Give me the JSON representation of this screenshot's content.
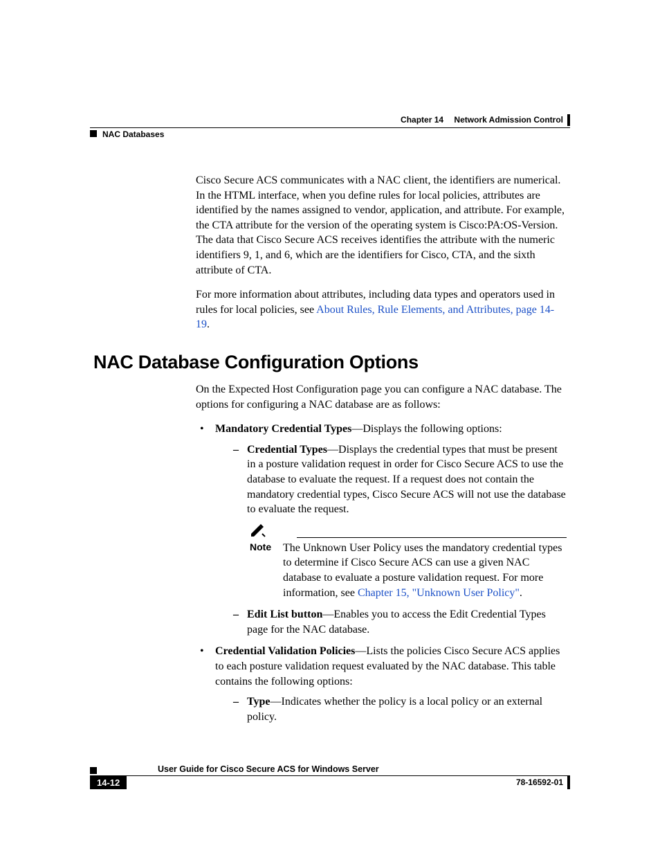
{
  "header": {
    "chapter_label": "Chapter 14",
    "chapter_title": "Network Admission Control",
    "section_crumb": "NAC Databases"
  },
  "intro": {
    "p1": "Cisco Secure ACS communicates with a NAC client, the identifiers are numerical. In the HTML interface, when you define rules for local policies, attributes are identified by the names assigned to vendor, application, and attribute. For example, the CTA attribute for the version of the operating system is Cisco:PA:OS-Version. The data that Cisco Secure ACS receives identifies the attribute with the numeric identifiers 9, 1, and 6, which are the identifiers for Cisco, CTA, and the sixth attribute of CTA.",
    "p2_pre": "For more information about attributes, including data types and operators used in rules for local policies, see ",
    "p2_link": "About Rules, Rule Elements, and Attributes, page 14-19",
    "p2_post": "."
  },
  "heading": "NAC Database Configuration Options",
  "body": {
    "intro": "On the Expected Host Configuration page you can configure a NAC database. The options for configuring a NAC database are as follows:",
    "b1_label": "Mandatory Credential Types",
    "b1_text": "—Displays the following options:",
    "b1a_label": "Credential Types",
    "b1a_text": "—Displays the credential types that must be present in a posture validation request in order for Cisco Secure ACS to use the database to evaluate the request. If a request does not contain the mandatory credential types, Cisco Secure ACS will not use the database to evaluate the request.",
    "note_label": "Note",
    "note_text_pre": "The Unknown User Policy uses the mandatory credential types to determine if Cisco Secure ACS can use a given NAC database to evaluate a posture validation request. For more information, see ",
    "note_link": "Chapter 15, \"Unknown User Policy\"",
    "note_text_post": ".",
    "b1b_label": "Edit List button",
    "b1b_text": "—Enables you to access the Edit Credential Types page for the NAC database.",
    "b2_label": "Credential Validation Policies",
    "b2_text": "—Lists the policies Cisco Secure ACS applies to each posture validation request evaluated by the NAC database. This table contains the following options:",
    "b2a_label": "Type",
    "b2a_text": "—Indicates whether the policy is a local policy or an external policy."
  },
  "footer": {
    "guide": "User Guide for Cisco Secure ACS for Windows Server",
    "page": "14-12",
    "doc": "78-16592-01"
  }
}
